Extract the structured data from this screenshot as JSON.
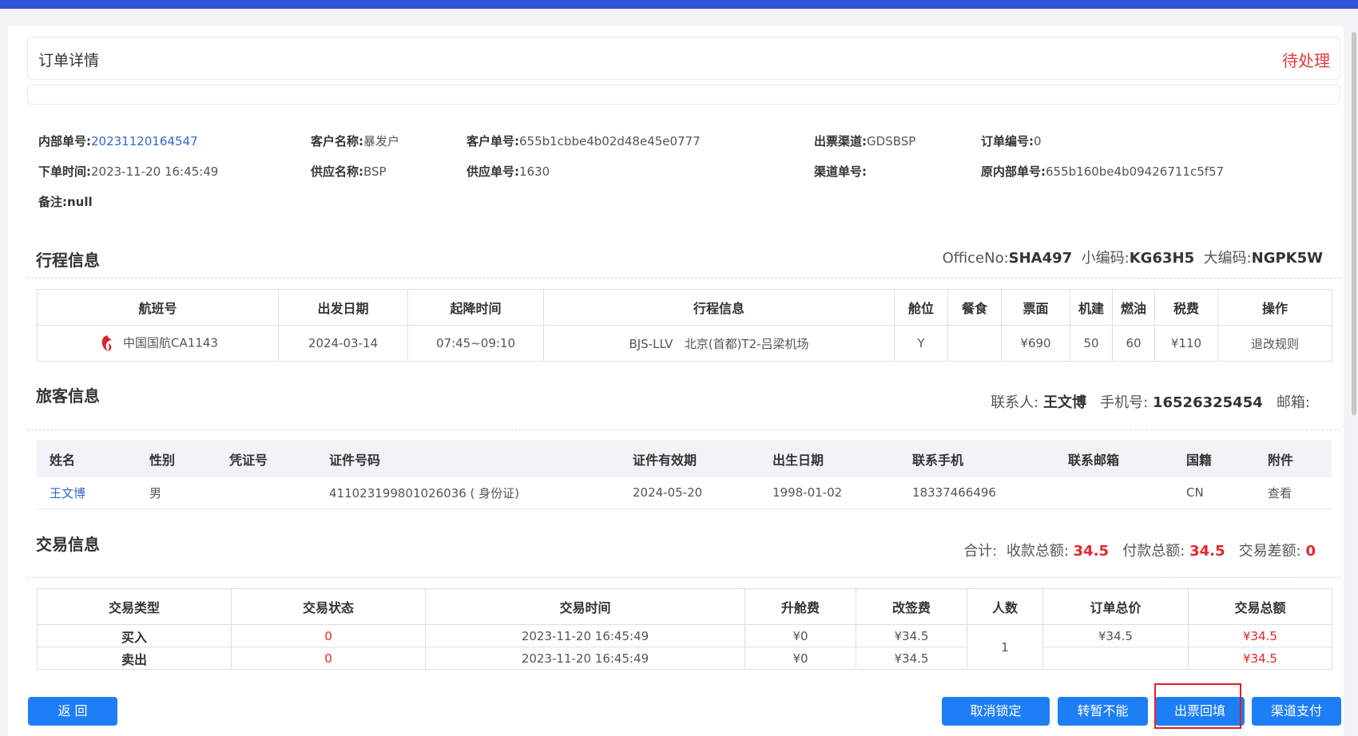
{
  "header": {
    "title": "订单详情",
    "status": "待处理"
  },
  "order": {
    "internal_no_label": "内部单号:",
    "internal_no": "20231120164547",
    "customer_name_label": "客户名称:",
    "customer_name": "暴发户",
    "customer_no_label": "客户单号:",
    "customer_no": "655b1cbbe4b02d48e45e0777",
    "channel_label": "出票渠道:",
    "channel": "GDSBSP",
    "order_no_label": "订单编号:",
    "order_no": "0",
    "order_time_label": "下单时间:",
    "order_time": "2023-11-20 16:45:49",
    "supplier_name_label": "供应名称:",
    "supplier_name": "BSP",
    "supplier_no_label": "供应单号:",
    "supplier_no": "1630",
    "channel_no_label": "渠道单号:",
    "channel_no": "",
    "orig_internal_no_label": "原内部单号:",
    "orig_internal_no": "655b160be4b09426711c5f57",
    "remark_label": "备注:",
    "remark": "null"
  },
  "itinerary": {
    "title": "行程信息",
    "office_label": "OfficeNo:",
    "office": "SHA497",
    "small_code_label": "小编码:",
    "small_code": "KG63H5",
    "big_code_label": "大编码:",
    "big_code": "NGPK5W",
    "columns": [
      "航班号",
      "出发日期",
      "起降时间",
      "行程信息",
      "舱位",
      "餐食",
      "票面",
      "机建",
      "燃油",
      "税费",
      "操作"
    ],
    "row": {
      "flight": "中国国航CA1143",
      "date": "2024-03-14",
      "time": "07:45~09:10",
      "route": "BJS-LLV   北京(首都)T2-吕梁机场",
      "cabin": "Y",
      "meal": "",
      "fare": "¥690",
      "airport_fee": "50",
      "fuel": "60",
      "tax": "¥110",
      "action": "退改规则"
    }
  },
  "passenger": {
    "title": "旅客信息",
    "contact_label": "联系人:",
    "contact": "王文博",
    "phone_label": "手机号:",
    "phone": "16526325454",
    "email_label": "邮箱:",
    "email": "",
    "columns": [
      "姓名",
      "性别",
      "凭证号",
      "证件号码",
      "证件有效期",
      "出生日期",
      "联系手机",
      "联系邮箱",
      "国籍",
      "附件"
    ],
    "row": {
      "name": "王文博",
      "gender": "男",
      "voucher": "",
      "id_no": "411023199801026036 ( 身份证)",
      "id_expiry": "2024-05-20",
      "birth": "1998-01-02",
      "mobile": "18337466496",
      "email": "",
      "nationality": "CN",
      "attachment": "查看"
    }
  },
  "transaction": {
    "title": "交易信息",
    "total_label": "合计:",
    "receive_label": "收款总额:",
    "receive": "34.5",
    "pay_label": "付款总额:",
    "pay": "34.5",
    "diff_label": "交易差额:",
    "diff": "0",
    "columns": [
      "交易类型",
      "交易状态",
      "交易时间",
      "升舱费",
      "改签费",
      "人数",
      "订单总价",
      "交易总额"
    ],
    "rows": [
      {
        "type": "买入",
        "status": "0",
        "time": "2023-11-20 16:45:49",
        "upgrade": "¥0",
        "change": "¥34.5",
        "order_total": "¥34.5",
        "trade_total": "¥34.5"
      },
      {
        "type": "卖出",
        "status": "0",
        "time": "2023-11-20 16:45:49",
        "upgrade": "¥0",
        "change": "¥34.5",
        "order_total": "",
        "trade_total": "¥34.5"
      }
    ],
    "people": "1"
  },
  "buttons": {
    "back": "返 回",
    "cancel_lock": "取消锁定",
    "transfer": "转暂不能",
    "ticket_fill": "出票回填",
    "channel_pay": "渠道支付"
  },
  "colors": {
    "primary": "#1e7ef5",
    "danger": "#e4262a",
    "topbar": "#2f55d4"
  }
}
